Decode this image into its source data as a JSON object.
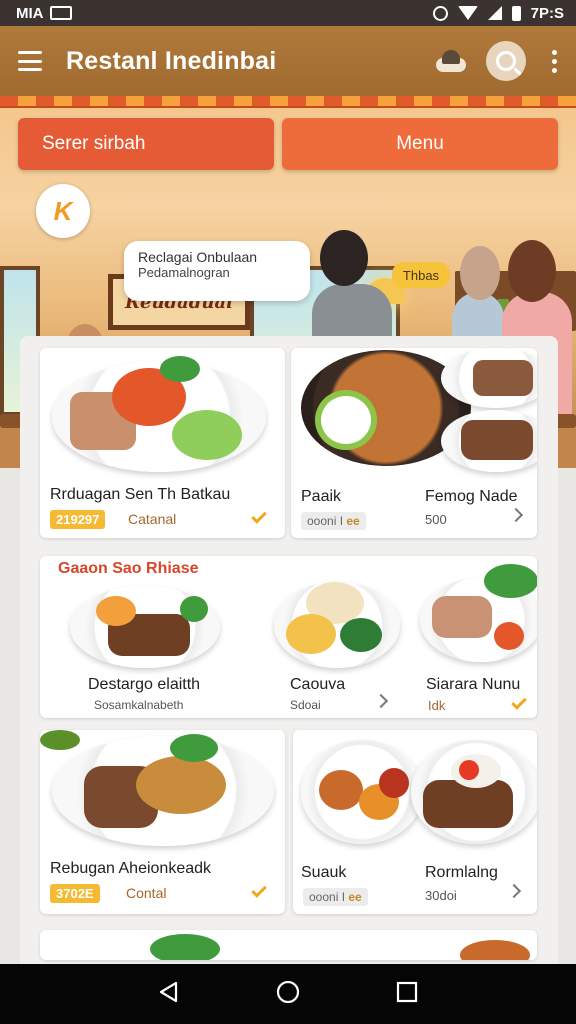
{
  "status_bar": {
    "left_text": "MIA",
    "right_text": "7P:S",
    "icons": [
      "image-icon",
      "alarm-icon",
      "wifi-icon",
      "signal-icon",
      "battery-icon"
    ]
  },
  "app_bar": {
    "title": "Restanl Inedinbai",
    "icons": [
      "menu-icon",
      "profile-cloud-icon",
      "search-icon",
      "more-vert-icon"
    ]
  },
  "hero": {
    "tab_left": "Serer sirbah",
    "tab_right": "Menu",
    "badge_icon": "k-badge-icon",
    "sign_text": "Reudaduai",
    "promo_line1": "Reclagai Onbulaan",
    "promo_line2": "Pedamalnogran",
    "bubble_text": "Thbas"
  },
  "cards_row1": [
    {
      "title": "Rrduagan Sen Th Batkau",
      "price": "219297",
      "sub": "Catanal"
    },
    {
      "title_left": "Paaik",
      "title_right": "Femog Nade",
      "chip": "oooni I",
      "chip_extra": "ee",
      "num": "500"
    }
  ],
  "section": {
    "label": "Gaaon Sao Rhiase"
  },
  "cards_row2": [
    {
      "title": "Destargo elaitth",
      "sub": "Sosamkalnabeth"
    },
    {
      "title": "Caouva",
      "sub": "Sdoai"
    },
    {
      "title": "Siarara Nunu",
      "sub": "Idk"
    }
  ],
  "cards_row3": [
    {
      "title": "Rebugan Aheionkeadk",
      "price": "3702E",
      "sub": "Contal"
    },
    {
      "title_left": "Suauk",
      "title_right": "Rormlalng",
      "chip": "oooni I",
      "chip_extra": "ee",
      "num": "30doi"
    }
  ],
  "colors": {
    "app_bar": "#a06a30",
    "accent_orange": "#ee6b3c",
    "price_yellow": "#f5b932",
    "section_red": "#d8462a"
  },
  "nav_bar": {
    "icons": [
      "back-icon",
      "home-icon",
      "recents-icon"
    ]
  }
}
